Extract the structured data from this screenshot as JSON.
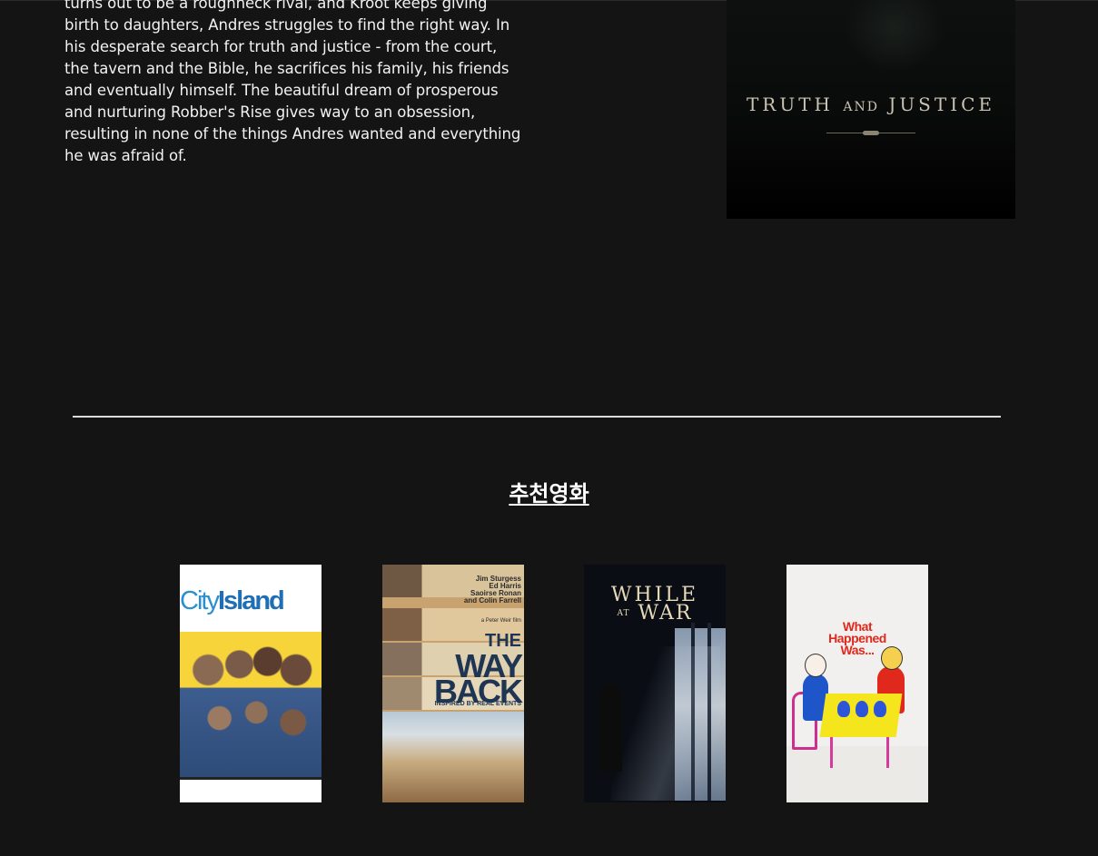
{
  "synopsis": {
    "lines": [
      "turns out to be a roughneck rival, and Kroot keeps giving",
      "birth to daughters, Andres struggles to find the right way. In",
      "his desperate search for truth and justice - from the court,",
      "the tavern and the Bible, he sacrifices his family, his friends",
      "and eventually himself. The beautiful dream of prosperous",
      "and nurturing Robber's Rise gives way to an obsession,",
      "resulting in none of the things Andres wanted and everything",
      "he was afraid of."
    ]
  },
  "main_poster": {
    "title_parts": [
      "TRUTH",
      "AND",
      "JUSTICE"
    ]
  },
  "recommend": {
    "section_title": "추천영화",
    "movies": [
      {
        "poster_text_1": "City",
        "poster_text_2": "Island"
      },
      {
        "names": [
          "Jim Sturgess",
          "Ed Harris",
          "Saoirse Ronan",
          "and Colin Farrell"
        ],
        "director": "a Peter Weir film",
        "title_a": "THE",
        "title_b": "WAY",
        "title_c": "BACK",
        "tagline": "INSPIRED BY REAL EVENTS"
      },
      {
        "title_l1": "WHILE",
        "title_at": "AT",
        "title_l2": "WAR"
      },
      {
        "title_l1": "What",
        "title_l2": "Happened",
        "title_l3": "Was..."
      }
    ]
  },
  "colors": {
    "background": "#141414",
    "divider": "#dcdcdc",
    "text": "#f2f2f2"
  }
}
